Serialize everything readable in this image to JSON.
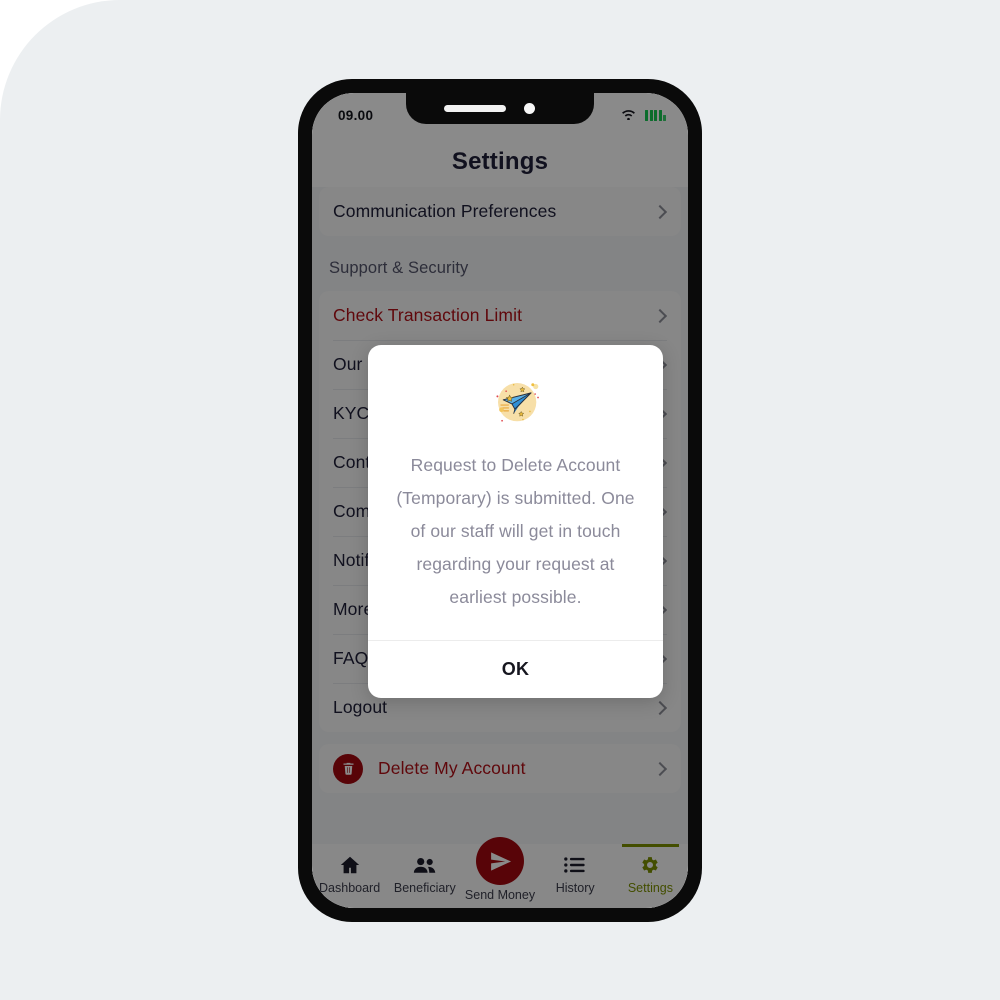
{
  "status_bar": {
    "time": "09.00",
    "wifi_icon": "wifi-icon",
    "battery_icon": "battery-full-icon"
  },
  "header": {
    "title": "Settings"
  },
  "settings": {
    "top_card": {
      "items": [
        {
          "label": "Communication Preferences",
          "chevron": "chevron-right-icon"
        }
      ]
    },
    "section_title": "Support & Security",
    "support_card": {
      "items": [
        {
          "label": "Check Transaction Limit",
          "chevron": "chevron-right-icon",
          "danger": true
        },
        {
          "label": "Our Branches",
          "chevron": "chevron-right-icon",
          "danger": false
        },
        {
          "label": "KYC Documents",
          "chevron": "chevron-right-icon",
          "danger": false
        },
        {
          "label": "Contact Us",
          "chevron": "chevron-right-icon",
          "danger": false
        },
        {
          "label": "Complaints",
          "chevron": "chevron-right-icon",
          "danger": false
        },
        {
          "label": "Notifications",
          "chevron": "chevron-right-icon",
          "danger": false
        },
        {
          "label": "More Info",
          "chevron": "chevron-right-icon",
          "danger": false
        },
        {
          "label": "FAQs",
          "chevron": "chevron-right-icon",
          "danger": false
        },
        {
          "label": "Logout",
          "chevron": "chevron-right-icon",
          "danger": false
        }
      ]
    },
    "delete_card": {
      "icon": "trash-icon",
      "label": "Delete My Account",
      "chevron": "chevron-right-icon"
    }
  },
  "modal": {
    "illustration": "paper-plane-illustration",
    "message": "Request to Delete Account (Temporary) is submitted. One of our staff will get in touch regarding your request at earliest possible.",
    "ok_label": "OK"
  },
  "bottom_nav": {
    "items": [
      {
        "label": "Dashboard",
        "icon": "home-icon",
        "active": false
      },
      {
        "label": "Beneficiary",
        "icon": "people-icon",
        "active": false
      },
      {
        "label": "Send Money",
        "icon": "paper-plane-icon",
        "active": false
      },
      {
        "label": "History",
        "icon": "list-icon",
        "active": false
      },
      {
        "label": "Settings",
        "icon": "gear-icon",
        "active": true
      }
    ]
  },
  "colors": {
    "brand_red": "#a3090f",
    "danger_text": "#b11017",
    "active_nav": "#7d9100",
    "title_text": "#20203a",
    "modal_text": "#8b8a9a",
    "page_background": "#eceff1"
  }
}
